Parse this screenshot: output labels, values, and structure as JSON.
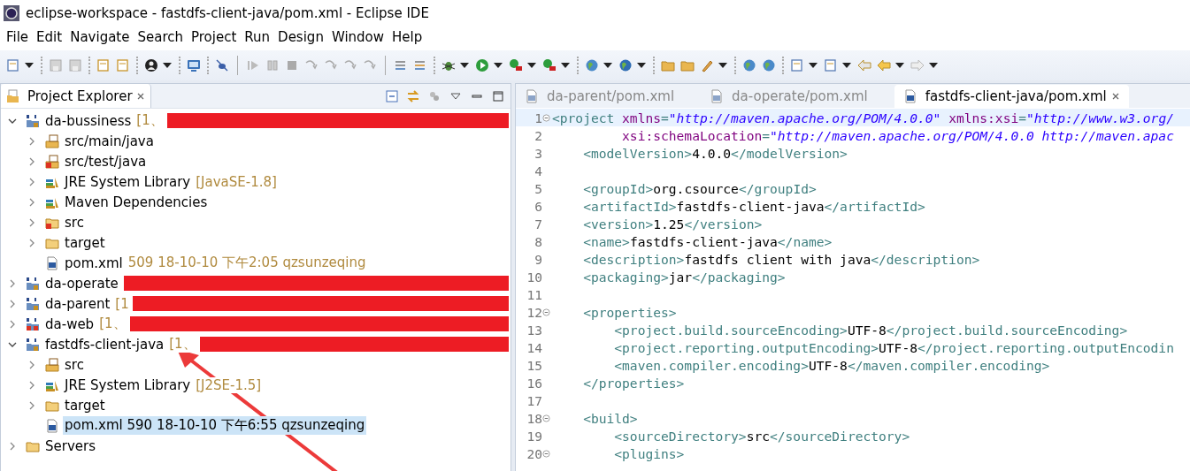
{
  "window": {
    "title": "eclipse-workspace - fastdfs-client-java/pom.xml - Eclipse IDE"
  },
  "menu": [
    "File",
    "Edit",
    "Navigate",
    "Search",
    "Project",
    "Run",
    "Design",
    "Window",
    "Help"
  ],
  "explorer": {
    "title": "Project Explorer",
    "items": [
      {
        "label": "da-bussiness",
        "decoration": "[1、",
        "kind": "project",
        "expanded": true,
        "selected": false,
        "redacted": true,
        "children": [
          {
            "label": "src/main/java",
            "kind": "source-folder",
            "expanded": false,
            "selected": false
          },
          {
            "label": "src/test/java",
            "kind": "source-folder-error",
            "expanded": false,
            "selected": false
          },
          {
            "label": "JRE System Library",
            "decoration": "[JavaSE-1.8]",
            "kind": "library",
            "expanded": false,
            "selected": false
          },
          {
            "label": "Maven Dependencies",
            "kind": "library",
            "expanded": false,
            "selected": false
          },
          {
            "label": "src",
            "kind": "folder-error",
            "expanded": false,
            "selected": false
          },
          {
            "label": "target",
            "kind": "folder",
            "expanded": false,
            "selected": false
          },
          {
            "label": "pom.xml",
            "decoration": "509  18-10-10 下午2:05  qzsunzeqing",
            "kind": "file",
            "selected": false
          }
        ]
      },
      {
        "label": "da-operate",
        "kind": "project",
        "expanded": false,
        "selected": false,
        "redacted": true
      },
      {
        "label": "da-parent",
        "decoration": "[1",
        "kind": "project",
        "expanded": false,
        "selected": false,
        "redacted": true
      },
      {
        "label": "da-web",
        "decoration": "[1、",
        "kind": "project-error",
        "expanded": false,
        "selected": false,
        "redacted": true
      },
      {
        "label": "fastdfs-client-java",
        "decoration": "[1、",
        "kind": "project",
        "expanded": true,
        "selected": false,
        "redacted": true,
        "children": [
          {
            "label": "src",
            "kind": "source-folder",
            "expanded": false,
            "selected": false
          },
          {
            "label": "JRE System Library",
            "decoration": "[J2SE-1.5]",
            "kind": "library",
            "expanded": false,
            "selected": false
          },
          {
            "label": "target",
            "kind": "folder",
            "expanded": false,
            "selected": false
          },
          {
            "label": "pom.xml 590  18-10-10 下午6:55  qzsunzeqing",
            "kind": "file",
            "selected": true
          }
        ]
      },
      {
        "label": "Servers",
        "kind": "folder",
        "expanded": false,
        "selected": false,
        "redacted": false
      }
    ]
  },
  "editor": {
    "tabs": [
      {
        "label": "da-parent/pom.xml",
        "selected": false
      },
      {
        "label": "da-operate/pom.xml",
        "selected": false
      },
      {
        "label": "fastdfs-client-java/pom.xml",
        "selected": true
      }
    ],
    "lines": [
      {
        "number": "1",
        "fold": true,
        "current": true,
        "segments": [
          {
            "kind": "tag",
            "text": "<project "
          },
          {
            "kind": "attr",
            "text": "xmlns"
          },
          {
            "kind": "tag",
            "text": "="
          },
          {
            "kind": "string",
            "text": "\"http://maven.apache.org/POM/4.0.0\""
          },
          {
            "kind": "attr",
            "text": " xmlns:xsi"
          },
          {
            "kind": "tag",
            "text": "="
          },
          {
            "kind": "string",
            "text": "\"http://www.w3.org/"
          }
        ]
      },
      {
        "number": "2",
        "fold": false,
        "current": false,
        "segments": [
          {
            "kind": "attr",
            "text": "         xsi:schemaLocation"
          },
          {
            "kind": "tag",
            "text": "="
          },
          {
            "kind": "string",
            "text": "\"http://maven.apache.org/POM/4.0.0 http://maven.apac"
          }
        ]
      },
      {
        "number": "3",
        "fold": false,
        "current": false,
        "segments": [
          {
            "kind": "tag",
            "text": "    <modelVersion>"
          },
          {
            "kind": "text",
            "text": "4.0.0"
          },
          {
            "kind": "tag",
            "text": "</modelVersion>"
          }
        ]
      },
      {
        "number": "4",
        "fold": false,
        "current": false
      },
      {
        "number": "5",
        "fold": false,
        "current": false,
        "segments": [
          {
            "kind": "tag",
            "text": "    <groupId>"
          },
          {
            "kind": "text",
            "text": "org.csource"
          },
          {
            "kind": "tag",
            "text": "</groupId>"
          }
        ]
      },
      {
        "number": "6",
        "fold": false,
        "current": false,
        "segments": [
          {
            "kind": "tag",
            "text": "    <artifactId>"
          },
          {
            "kind": "text",
            "text": "fastdfs-client-java"
          },
          {
            "kind": "tag",
            "text": "</artifactId>"
          }
        ]
      },
      {
        "number": "7",
        "fold": false,
        "current": false,
        "segments": [
          {
            "kind": "tag",
            "text": "    <version>"
          },
          {
            "kind": "text",
            "text": "1.25"
          },
          {
            "kind": "tag",
            "text": "</version>"
          }
        ]
      },
      {
        "number": "8",
        "fold": false,
        "current": false,
        "segments": [
          {
            "kind": "tag",
            "text": "    <name>"
          },
          {
            "kind": "text",
            "text": "fastdfs-client-java"
          },
          {
            "kind": "tag",
            "text": "</name>"
          }
        ]
      },
      {
        "number": "9",
        "fold": false,
        "current": false,
        "segments": [
          {
            "kind": "tag",
            "text": "    <description>"
          },
          {
            "kind": "text",
            "text": "fastdfs client with java"
          },
          {
            "kind": "tag",
            "text": "</description>"
          }
        ]
      },
      {
        "number": "10",
        "fold": false,
        "current": false,
        "segments": [
          {
            "kind": "tag",
            "text": "    <packaging>"
          },
          {
            "kind": "text",
            "text": "jar"
          },
          {
            "kind": "tag",
            "text": "</packaging>"
          }
        ]
      },
      {
        "number": "11",
        "fold": false,
        "current": false
      },
      {
        "number": "12",
        "fold": true,
        "current": false,
        "segments": [
          {
            "kind": "tag",
            "text": "    <properties>"
          }
        ]
      },
      {
        "number": "13",
        "fold": false,
        "current": false,
        "segments": [
          {
            "kind": "tag",
            "text": "        <project.build.sourceEncoding>"
          },
          {
            "kind": "text",
            "text": "UTF-8"
          },
          {
            "kind": "tag",
            "text": "</project.build.sourceEncoding>"
          }
        ]
      },
      {
        "number": "14",
        "fold": false,
        "current": false,
        "segments": [
          {
            "kind": "tag",
            "text": "        <project.reporting.outputEncoding>"
          },
          {
            "kind": "text",
            "text": "UTF-8"
          },
          {
            "kind": "tag",
            "text": "</project.reporting.outputEncodin"
          }
        ]
      },
      {
        "number": "15",
        "fold": false,
        "current": false,
        "segments": [
          {
            "kind": "tag",
            "text": "        <maven.compiler.encoding>"
          },
          {
            "kind": "text",
            "text": "UTF-8"
          },
          {
            "kind": "tag",
            "text": "</maven.compiler.encoding>"
          }
        ]
      },
      {
        "number": "16",
        "fold": false,
        "current": false,
        "segments": [
          {
            "kind": "tag",
            "text": "    </properties>"
          }
        ]
      },
      {
        "number": "17",
        "fold": false,
        "current": false
      },
      {
        "number": "18",
        "fold": true,
        "current": false,
        "segments": [
          {
            "kind": "tag",
            "text": "    <build>"
          }
        ]
      },
      {
        "number": "19",
        "fold": false,
        "current": false,
        "segments": [
          {
            "kind": "tag",
            "text": "        <sourceDirectory>"
          },
          {
            "kind": "text",
            "text": "src"
          },
          {
            "kind": "tag",
            "text": "</sourceDirectory>"
          }
        ]
      },
      {
        "number": "20",
        "fold": true,
        "current": false,
        "segments": [
          {
            "kind": "tag",
            "text": "        <plugins>"
          }
        ]
      }
    ]
  }
}
